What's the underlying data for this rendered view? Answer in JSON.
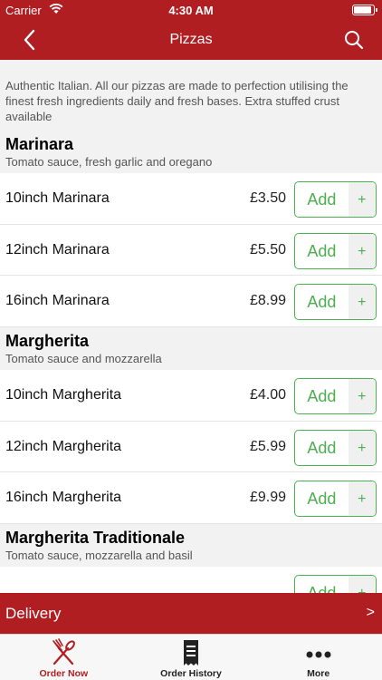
{
  "status_bar": {
    "carrier": "Carrier",
    "time": "4:30 AM"
  },
  "nav": {
    "title": "Pizzas"
  },
  "intro": "Authentic Italian. All our pizzas are made to perfection utilising the finest fresh ingredients daily and fresh bases. Extra stuffed crust available",
  "add_label": "Add",
  "plus_label": "+",
  "sections": [
    {
      "name": "Marinara",
      "description": "Tomato sauce, fresh garlic and oregano",
      "items": [
        {
          "name": "10inch Marinara",
          "price": "£3.50"
        },
        {
          "name": "12inch Marinara",
          "price": "£5.50"
        },
        {
          "name": "16inch Marinara",
          "price": "£8.99"
        }
      ]
    },
    {
      "name": "Margherita",
      "description": "Tomato sauce and mozzarella",
      "items": [
        {
          "name": "10inch Margherita",
          "price": "£4.00"
        },
        {
          "name": "12inch Margherita",
          "price": "£5.99"
        },
        {
          "name": "16inch Margherita",
          "price": "£9.99"
        }
      ]
    },
    {
      "name": "Margherita Traditionale",
      "description": "Tomato sauce, mozzarella and basil",
      "items": [
        {
          "name": "",
          "price": ""
        }
      ]
    }
  ],
  "delivery": {
    "label": "Delivery",
    "arrow": ">"
  },
  "tabs": [
    {
      "label": "Order Now",
      "icon": "fork-knife-icon",
      "active": true
    },
    {
      "label": "Order History",
      "icon": "receipt-icon",
      "active": false
    },
    {
      "label": "More",
      "icon": "more-dots-icon",
      "active": false
    }
  ],
  "colors": {
    "brand": "#b01e22",
    "accent": "#4caf50"
  }
}
